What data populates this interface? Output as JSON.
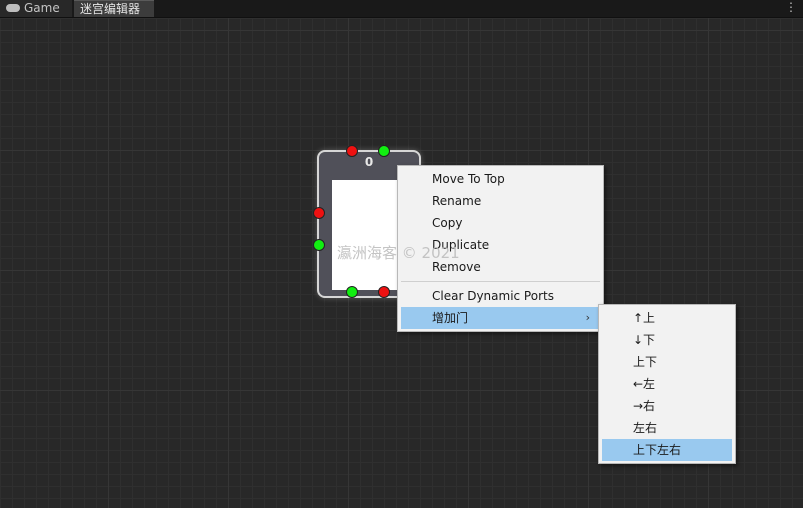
{
  "tabs": {
    "game_label": "Game",
    "editor_label": "迷宫编辑器",
    "menu_glyph": "⋮"
  },
  "node": {
    "title": "0"
  },
  "context_menu": {
    "items": [
      "Move To Top",
      "Rename",
      "Copy",
      "Duplicate",
      "Remove"
    ],
    "clear_label": "Clear Dynamic Ports",
    "add_door_label": "增加门",
    "submenu_arrow": "›"
  },
  "submenu": {
    "items": [
      "↑上",
      "↓下",
      "上下",
      "←左",
      "→右",
      "左右",
      "上下左右"
    ]
  },
  "watermark": "瀛洲海客 © 2021",
  "colors": {
    "port_red": "#ee1111",
    "port_green": "#11ee11",
    "highlight": "#99c9ef"
  }
}
